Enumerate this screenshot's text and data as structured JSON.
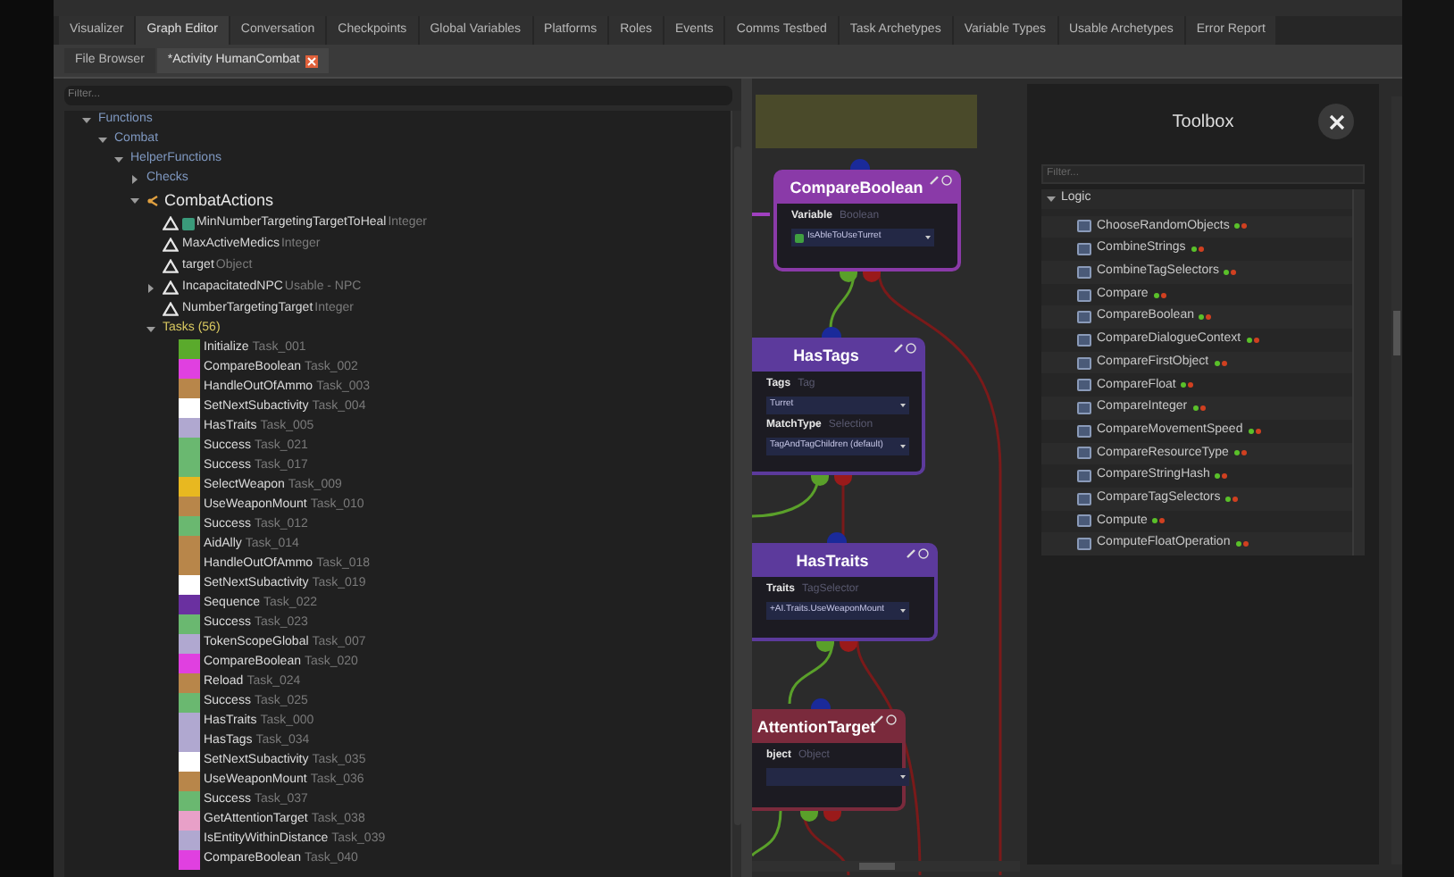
{
  "main_tabs": [
    {
      "label": "Visualizer",
      "selected": false
    },
    {
      "label": "Graph Editor",
      "selected": true
    },
    {
      "label": "Conversation",
      "selected": false
    },
    {
      "label": "Checkpoints",
      "selected": false
    },
    {
      "label": "Global Variables",
      "selected": false
    },
    {
      "label": "Platforms",
      "selected": false
    },
    {
      "label": "Roles",
      "selected": false
    },
    {
      "label": "Events",
      "selected": false
    },
    {
      "label": "Comms Testbed",
      "selected": false
    },
    {
      "label": "Task Archetypes",
      "selected": false
    },
    {
      "label": "Variable Types",
      "selected": false
    },
    {
      "label": "Usable Archetypes",
      "selected": false
    },
    {
      "label": "Error Report",
      "selected": false
    }
  ],
  "document_tabs": [
    {
      "label": "File Browser",
      "selected": false,
      "closable": false
    },
    {
      "label": "*Activity HumanCombat",
      "selected": true,
      "closable": true
    }
  ],
  "tree": {
    "filter_placeholder": "Filter...",
    "items": [
      {
        "label": "Functions",
        "kind": "folder",
        "expanded": true,
        "children": [
          {
            "label": "Combat",
            "kind": "folder",
            "expanded": true,
            "children": [
              {
                "label": "HelperFunctions",
                "kind": "folder",
                "expanded": true,
                "children": [
                  {
                    "label": "Checks",
                    "kind": "folder",
                    "expanded": false
                  },
                  {
                    "label": "CombatActions",
                    "kind": "function",
                    "expanded": true,
                    "children": [
                      {
                        "label": "MinNumberTargetingTargetToHeal",
                        "kind": "variable",
                        "type": "Integer",
                        "input": true
                      },
                      {
                        "label": "MaxActiveMedics",
                        "kind": "variable",
                        "type": "Integer",
                        "input": false
                      },
                      {
                        "label": "target",
                        "kind": "variable",
                        "type": "Object",
                        "input": false
                      },
                      {
                        "label": "IncapacitatedNPC",
                        "kind": "variable",
                        "type": "Usable - NPC",
                        "input": false,
                        "expanded": false
                      },
                      {
                        "label": "NumberTargetingTarget",
                        "kind": "variable",
                        "type": "Integer",
                        "input": false
                      },
                      {
                        "label": "Tasks (56)",
                        "kind": "tasks",
                        "expanded": true,
                        "children": [
                          {
                            "label": "Initialize",
                            "kind": "task",
                            "id": "Task_001",
                            "color": "#5aaa2c"
                          },
                          {
                            "label": "CompareBoolean",
                            "kind": "task",
                            "id": "Task_002",
                            "color": "#e040e0"
                          },
                          {
                            "label": "HandleOutOfAmmo",
                            "kind": "task",
                            "id": "Task_003",
                            "color": "#b8864a"
                          },
                          {
                            "label": "SetNextSubactivity",
                            "kind": "task",
                            "id": "Task_004",
                            "color": "#ffffff"
                          },
                          {
                            "label": "HasTraits",
                            "kind": "task",
                            "id": "Task_005",
                            "color": "#b0a8d0"
                          },
                          {
                            "label": "Success",
                            "kind": "task",
                            "id": "Task_021",
                            "color": "#6ab870"
                          },
                          {
                            "label": "Success",
                            "kind": "task",
                            "id": "Task_017",
                            "color": "#6ab870"
                          },
                          {
                            "label": "SelectWeapon",
                            "kind": "task",
                            "id": "Task_009",
                            "color": "#e8b820"
                          },
                          {
                            "label": "UseWeaponMount",
                            "kind": "task",
                            "id": "Task_010",
                            "color": "#b8864a"
                          },
                          {
                            "label": "Success",
                            "kind": "task",
                            "id": "Task_012",
                            "color": "#6ab870"
                          },
                          {
                            "label": "AidAlly",
                            "kind": "task",
                            "id": "Task_014",
                            "color": "#b8864a"
                          },
                          {
                            "label": "HandleOutOfAmmo",
                            "kind": "task",
                            "id": "Task_018",
                            "color": "#b8864a"
                          },
                          {
                            "label": "SetNextSubactivity",
                            "kind": "task",
                            "id": "Task_019",
                            "color": "#ffffff"
                          },
                          {
                            "label": "Sequence",
                            "kind": "task",
                            "id": "Task_022",
                            "color": "#6a30a0"
                          },
                          {
                            "label": "Success",
                            "kind": "task",
                            "id": "Task_023",
                            "color": "#6ab870"
                          },
                          {
                            "label": "TokenScopeGlobal",
                            "kind": "task",
                            "id": "Task_007",
                            "color": "#b0a8d0"
                          },
                          {
                            "label": "CompareBoolean",
                            "kind": "task",
                            "id": "Task_020",
                            "color": "#e040e0"
                          },
                          {
                            "label": "Reload",
                            "kind": "task",
                            "id": "Task_024",
                            "color": "#b8864a"
                          },
                          {
                            "label": "Success",
                            "kind": "task",
                            "id": "Task_025",
                            "color": "#6ab870"
                          },
                          {
                            "label": "HasTraits",
                            "kind": "task",
                            "id": "Task_000",
                            "color": "#b0a8d0"
                          },
                          {
                            "label": "HasTags",
                            "kind": "task",
                            "id": "Task_034",
                            "color": "#b0a8d0"
                          },
                          {
                            "label": "SetNextSubactivity",
                            "kind": "task",
                            "id": "Task_035",
                            "color": "#ffffff"
                          },
                          {
                            "label": "UseWeaponMount",
                            "kind": "task",
                            "id": "Task_036",
                            "color": "#b8864a"
                          },
                          {
                            "label": "Success",
                            "kind": "task",
                            "id": "Task_037",
                            "color": "#6ab870"
                          },
                          {
                            "label": "GetAttentionTarget",
                            "kind": "task",
                            "id": "Task_038",
                            "color": "#e8a0c8"
                          },
                          {
                            "label": "IsEntityWithinDistance",
                            "kind": "task",
                            "id": "Task_039",
                            "color": "#b0a8d0"
                          },
                          {
                            "label": "CompareBoolean",
                            "kind": "task",
                            "id": "Task_040",
                            "color": "#e040e0"
                          }
                        ]
                      }
                    ]
                  }
                ]
              }
            ]
          }
        ]
      }
    ]
  },
  "graph": {
    "nodes": [
      {
        "title": "CompareBoolean",
        "color": "#8a3aa8",
        "fields": [
          {
            "label": "Variable",
            "type": "Boolean",
            "value": "IsAbleToUseTurret",
            "checked": true
          }
        ]
      },
      {
        "title": "HasTags",
        "color": "#5c3a9c",
        "fields": [
          {
            "label": "Tags",
            "type": "Tag",
            "value": "Turret"
          },
          {
            "label": "MatchType",
            "type": "Selection",
            "value": "TagAndTagChildren (default)"
          }
        ]
      },
      {
        "title": "HasTraits",
        "color": "#5c3a9c",
        "fields": [
          {
            "label": "Traits",
            "type": "TagSelector",
            "value": "+AI.Traits.UseWeaponMount"
          }
        ]
      },
      {
        "title": "AttentionTarget",
        "color": "#7a2a3c",
        "fields": [
          {
            "label": "bject",
            "type": "Object"
          }
        ]
      }
    ]
  },
  "toolbox": {
    "title": "Toolbox",
    "filter_placeholder": "Filter...",
    "category": {
      "label": "Logic",
      "expanded": true
    },
    "items": [
      "ChooseRandomObjects",
      "CombineStrings",
      "CombineTagSelectors",
      "Compare",
      "CompareBoolean",
      "CompareDialogueContext",
      "CompareFirstObject",
      "CompareFloat",
      "CompareInteger",
      "CompareMovementSpeed",
      "CompareResourceType",
      "CompareStringHash",
      "CompareTagSelectors",
      "Compute",
      "ComputeFloatOperation"
    ]
  }
}
